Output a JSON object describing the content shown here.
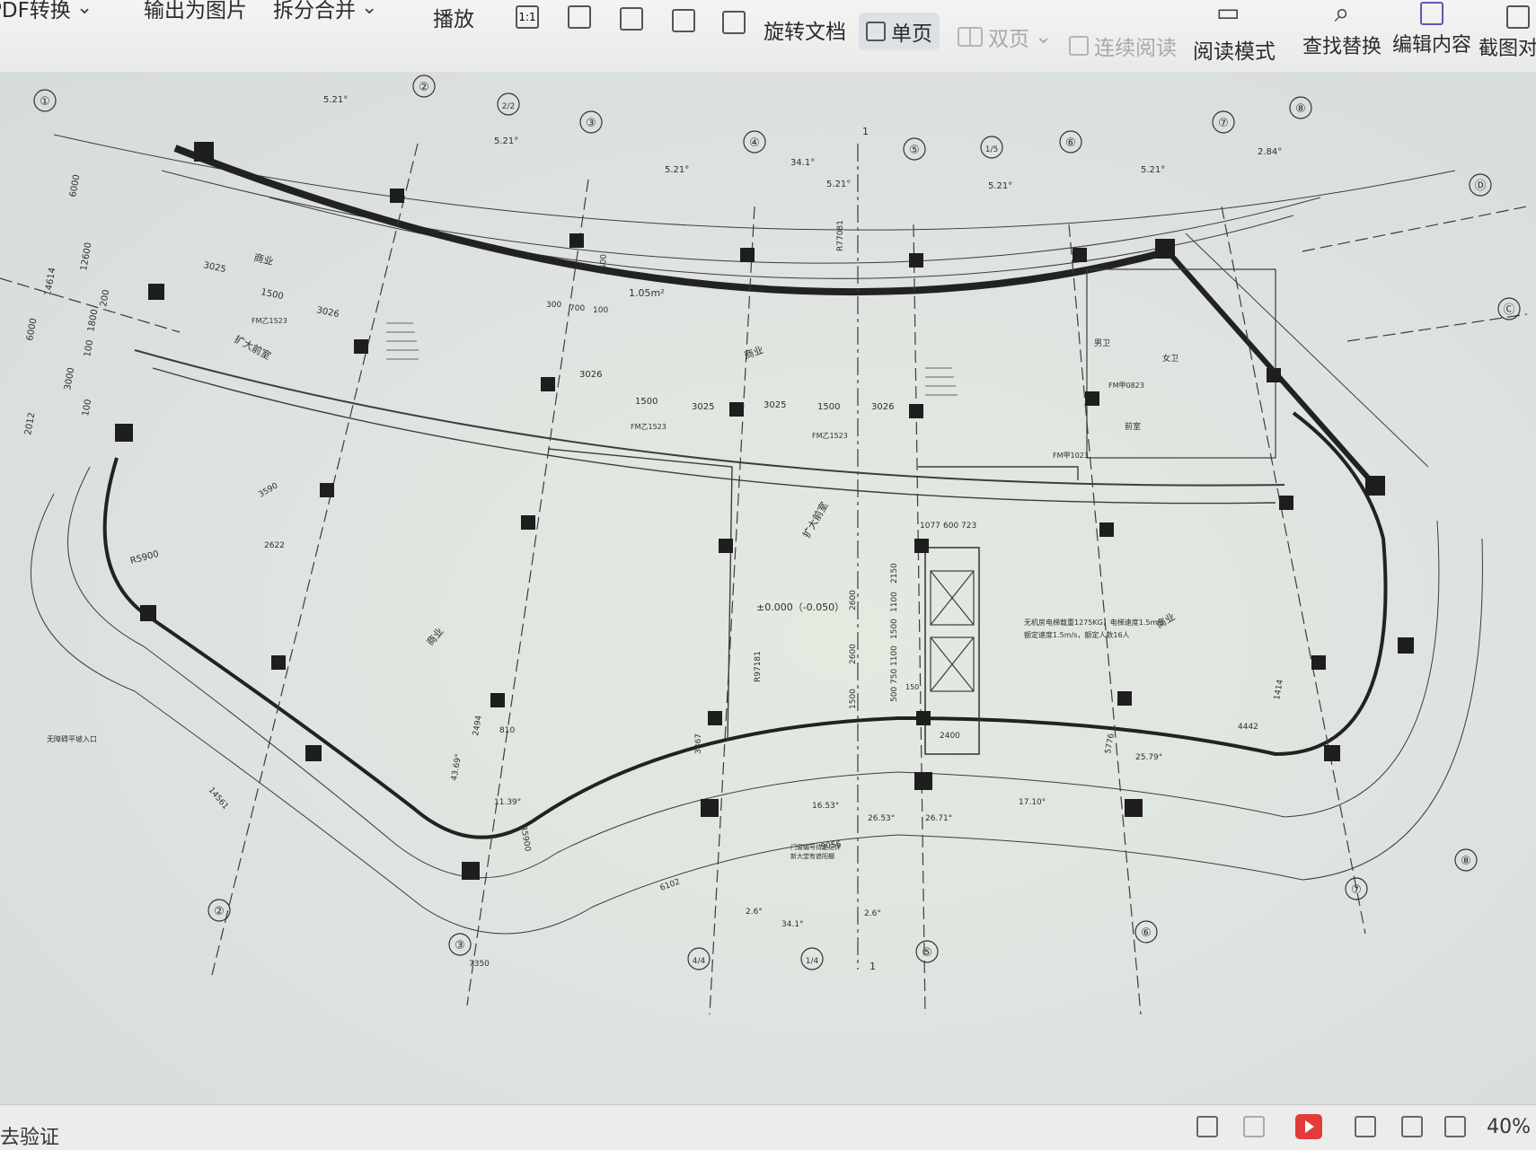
{
  "toolbar": {
    "pdf_convert": "PDF转换",
    "export_image": "输出为图片",
    "split_merge": "拆分合并",
    "play": "播放",
    "rotate_doc": "旋转文档",
    "single_page": "单页",
    "double_page": "双页",
    "continuous": "连续阅读",
    "read_mode": "阅读模式",
    "find_replace": "查找替换",
    "edit_content": "编辑内容",
    "screenshot_compare": "截图对比"
  },
  "drawing": {
    "axis_top": [
      "①",
      "②",
      "2/2",
      "③",
      "④",
      "⑤",
      "1/5",
      "⑥",
      "⑦",
      "⑧"
    ],
    "axis_right": [
      "Ⓓ",
      "Ⓒ",
      "Ⓑ"
    ],
    "angles_top": [
      "5.21°",
      "5.21°",
      "5.21°",
      "34.1°",
      "5.21°",
      "5.21°",
      "5.21°",
      "2.84°"
    ],
    "dims_left": [
      "6000",
      "12600",
      "14614",
      "6000",
      "1800",
      "3000",
      "2012",
      "200",
      "100",
      "100"
    ],
    "dims_row1": [
      "3025",
      "1500",
      "3026"
    ],
    "dims_row2": [
      "3026",
      "1500",
      "3025",
      "3025",
      "1500",
      "3026"
    ],
    "room_labels": [
      "商业",
      "扩大前室",
      "商业",
      "扩大前室",
      "商业",
      "男卫",
      "女卫",
      "前室",
      "商业"
    ],
    "door_labels": [
      "FM乙1523",
      "FM乙1523",
      "FM乙1523",
      "FM甲0823",
      "FM甲1023"
    ],
    "vent": "1.05m²",
    "vent_dims": [
      "1500",
      "300",
      "700",
      "100"
    ],
    "radius_labels": [
      "R77081",
      "R5900",
      "R97181",
      "R5900"
    ],
    "elevation": "±0.000（-0.050）",
    "elevator_note": [
      "无机房电梯载重1275KG，电梯速度1.5m/s",
      "额定速度1.5m/s，额定人数16人"
    ],
    "elevator_dims": [
      "1077",
      "600",
      "723",
      "2150",
      "1100",
      "1500",
      "1100",
      "750",
      "150",
      "500",
      "2600",
      "2600",
      "1500",
      "2400",
      "3867"
    ],
    "misc_dims": [
      "3590",
      "2622",
      "2494",
      "810",
      "43.69°",
      "11.39°",
      "14561",
      "4442",
      "1414",
      "9056",
      "6102",
      "5776",
      "25.79°",
      "16.53°",
      "26.53°",
      "17.10°",
      "26.71°",
      "7350",
      "2.6°",
      "2.6°",
      "34.1°"
    ],
    "axis_bottom": [
      "②",
      "③",
      "4/4",
      "1/4",
      "⑤",
      "⑥",
      "⑦",
      "⑧"
    ],
    "section_mark": "1",
    "entrance_note": "无障碍平坡入口",
    "door_note": [
      "门窗编号待定见详",
      "新大堂有遮阳棚"
    ]
  },
  "status": {
    "verify": "去验证",
    "zoom": "40%"
  }
}
